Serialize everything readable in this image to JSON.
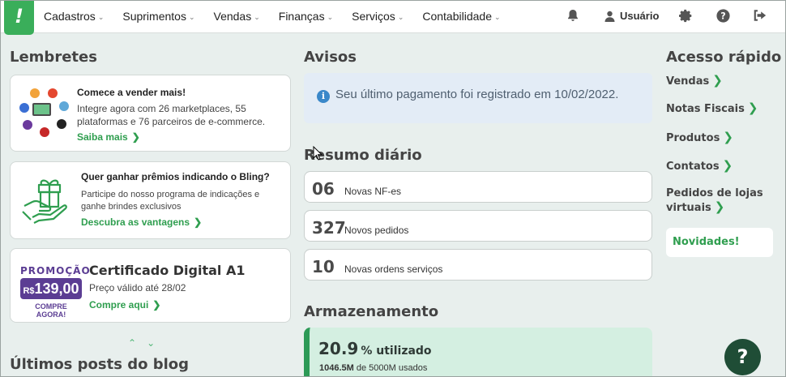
{
  "topnav": {
    "items": [
      "Cadastros",
      "Suprimentos",
      "Vendas",
      "Finanças",
      "Serviços",
      "Contabilidade"
    ],
    "user_label": "Usuário",
    "icons": [
      "bell-icon",
      "user-icon",
      "gear-icon",
      "help-icon",
      "logout-icon"
    ]
  },
  "reminders": {
    "title": "Lembretes",
    "cards": [
      {
        "heading": "Comece a vender mais!",
        "body": "Integre agora com 26 marketplaces, 55 plataformas e 76 parceiros de e-commerce.",
        "link": "Saiba mais"
      },
      {
        "heading": "Quer ganhar prêmios indicando o Bling?",
        "body": "Participe do nosso programa de indicações e ganhe brindes exclusivos",
        "link": "Descubra as vantagens"
      },
      {
        "promo_tag": "PROMOÇÃO",
        "promo_currency": "R$",
        "promo_price": "139,00",
        "promo_cta": "COMPRE AGORA!",
        "heading": "Certificado Digital A1",
        "body": "Preço válido até 28/02",
        "link": "Compre aqui"
      }
    ]
  },
  "blog": {
    "title": "Últimos posts do blog"
  },
  "notices": {
    "title": "Avisos",
    "message": "Seu último pagamento foi registrado em 10/02/2022."
  },
  "daily": {
    "title": "Resumo diário",
    "stats": [
      {
        "value": "06",
        "label": "Novas NF-es"
      },
      {
        "value": "327",
        "label": "Novos pedidos"
      },
      {
        "value": "10",
        "label": "Novas ordens serviços"
      }
    ]
  },
  "storage": {
    "title": "Armazenamento",
    "percent": "20.9",
    "percent_label": "% utilizado",
    "used": "1046.5M",
    "total_text": "de 5000M usados"
  },
  "quick": {
    "title": "Acesso rápido",
    "links": [
      "Vendas",
      "Notas Fiscais",
      "Produtos",
      "Contatos",
      "Pedidos de lojas virtuais"
    ],
    "news": "Novidades!"
  },
  "colors": {
    "brand_green": "#3aae5a",
    "promo_purple": "#5b3d93",
    "help_dark": "#1f4d36"
  }
}
